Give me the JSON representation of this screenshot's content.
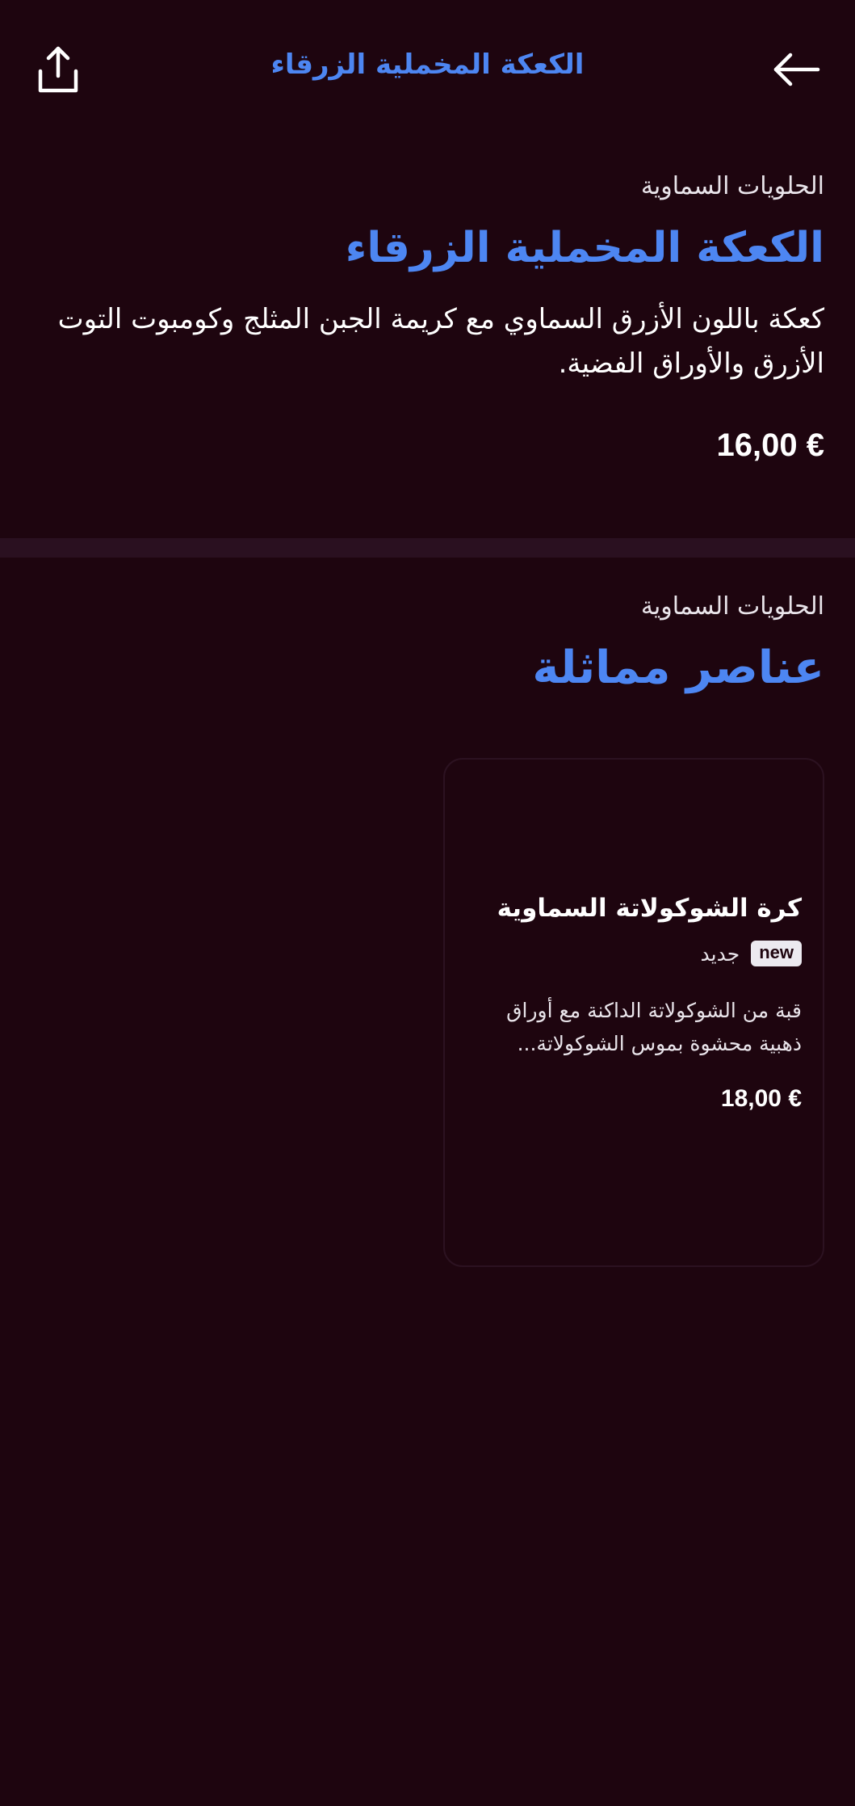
{
  "header": {
    "title": "الكعكة المخملية الزرقاء",
    "share_icon": "share-icon",
    "back_icon": "arrow-left-icon"
  },
  "product": {
    "category": "الحلويات السماوية",
    "title": "الكعكة المخملية الزرقاء",
    "description": "كعكة باللون الأزرق السماوي مع كريمة الجبن المثلج وكومبوت التوت الأزرق والأوراق الفضية.",
    "price": "16,00 €"
  },
  "similar": {
    "category": "الحلويات السماوية",
    "title": "عناصر مماثلة",
    "items": [
      {
        "title": "كرة الشوكولاتة السماوية",
        "badge": "new",
        "badge_label": "جديد",
        "description": "قبة من الشوكولاتة الداكنة مع أوراق ذهبية محشوة بموس الشوكولاتة...",
        "price": "18,00 €"
      }
    ]
  },
  "colors": {
    "background": "#1e050f",
    "accent": "#4d86f2",
    "text": "#ffffff"
  }
}
